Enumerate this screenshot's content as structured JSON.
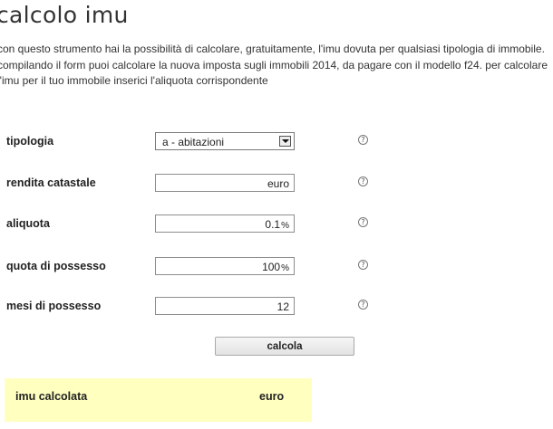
{
  "page": {
    "title": "calcolo imu",
    "intro": "con questo strumento hai la possibilità di calcolare, gratuitamente, l'imu dovuta per qualsiasi tipologia di immobile. compilando il form puoi calcolare la nuova imposta sugli immobili 2014, da pagare con il modello f24. per calcolare l'imu per il tuo immobile inserici l'aliquota corrispondente"
  },
  "form": {
    "tipologia": {
      "label": "tipologia",
      "selected": "a - abitazioni"
    },
    "rendita": {
      "label": "rendita catastale",
      "value": "",
      "unit": "euro"
    },
    "aliquota": {
      "label": "aliquota",
      "value": "0.1",
      "unit": "%"
    },
    "quota": {
      "label": "quota di possesso",
      "value": "100",
      "unit": "%"
    },
    "mesi": {
      "label": "mesi di possesso",
      "value": "12"
    },
    "help_glyph": "?",
    "submit_label": "calcola"
  },
  "result": {
    "label": "imu calcolata",
    "unit": "euro"
  }
}
